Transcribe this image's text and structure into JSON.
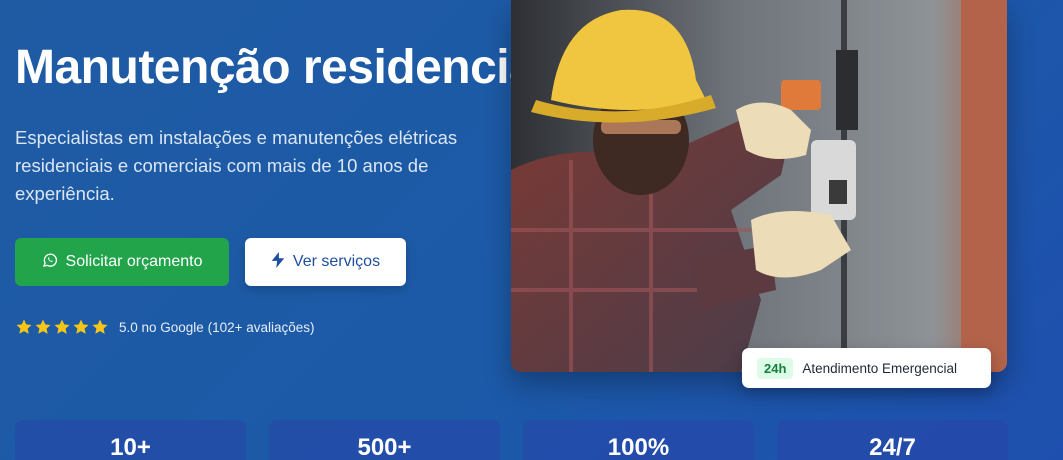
{
  "hero": {
    "title": "Manutenção residencial",
    "subtitle": "Especialistas em instalações e manutenções elétricas residenciais e comerciais com mais de 10 anos de experiência.",
    "primary_cta": "Solicitar orçamento",
    "secondary_cta": "Ver serviços",
    "rating_text": "5.0 no Google (102+ avaliações)",
    "rating_stars": 5
  },
  "badge": {
    "tag": "24h",
    "label": "Atendimento Emergencial"
  },
  "stats": [
    {
      "value": "10+"
    },
    {
      "value": "500+"
    },
    {
      "value": "100%"
    },
    {
      "value": "24/7"
    }
  ],
  "colors": {
    "primary_button": "#22a44a",
    "secondary_button_text": "#1d4f9c",
    "star": "#f5c518",
    "background": "#1f5ba3"
  },
  "icons": {
    "primary_cta": "whatsapp-icon",
    "secondary_cta": "lightning-icon",
    "rating": "star-icon"
  }
}
